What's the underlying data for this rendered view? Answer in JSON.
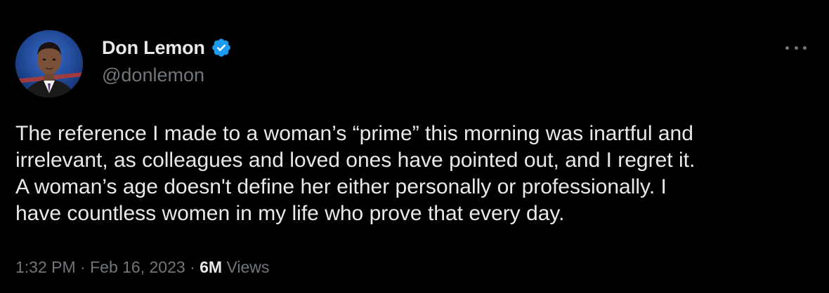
{
  "author": {
    "display_name": "Don Lemon",
    "handle": "@donlemon",
    "verified": true,
    "verified_badge_color": "#1d9bf0",
    "avatar_icon": "profile-photo"
  },
  "more_menu_icon": "more-horizontal-icon",
  "tweet": {
    "lines": [
      "The reference I made to a woman’s “prime” this morning was inartful and",
      "irrelevant, as colleagues and loved ones have pointed out, and I regret it.",
      "A woman’s age doesn't define her either personally or professionally. I",
      "have countless women in my life who prove that every day."
    ]
  },
  "meta": {
    "time": "1:32 PM",
    "separator": "·",
    "date": "Feb 16, 2023",
    "views_count": "6M",
    "views_label": "Views"
  },
  "colors": {
    "background": "#000000",
    "primary_text": "#e7e9ea",
    "secondary_text": "#71767b"
  }
}
